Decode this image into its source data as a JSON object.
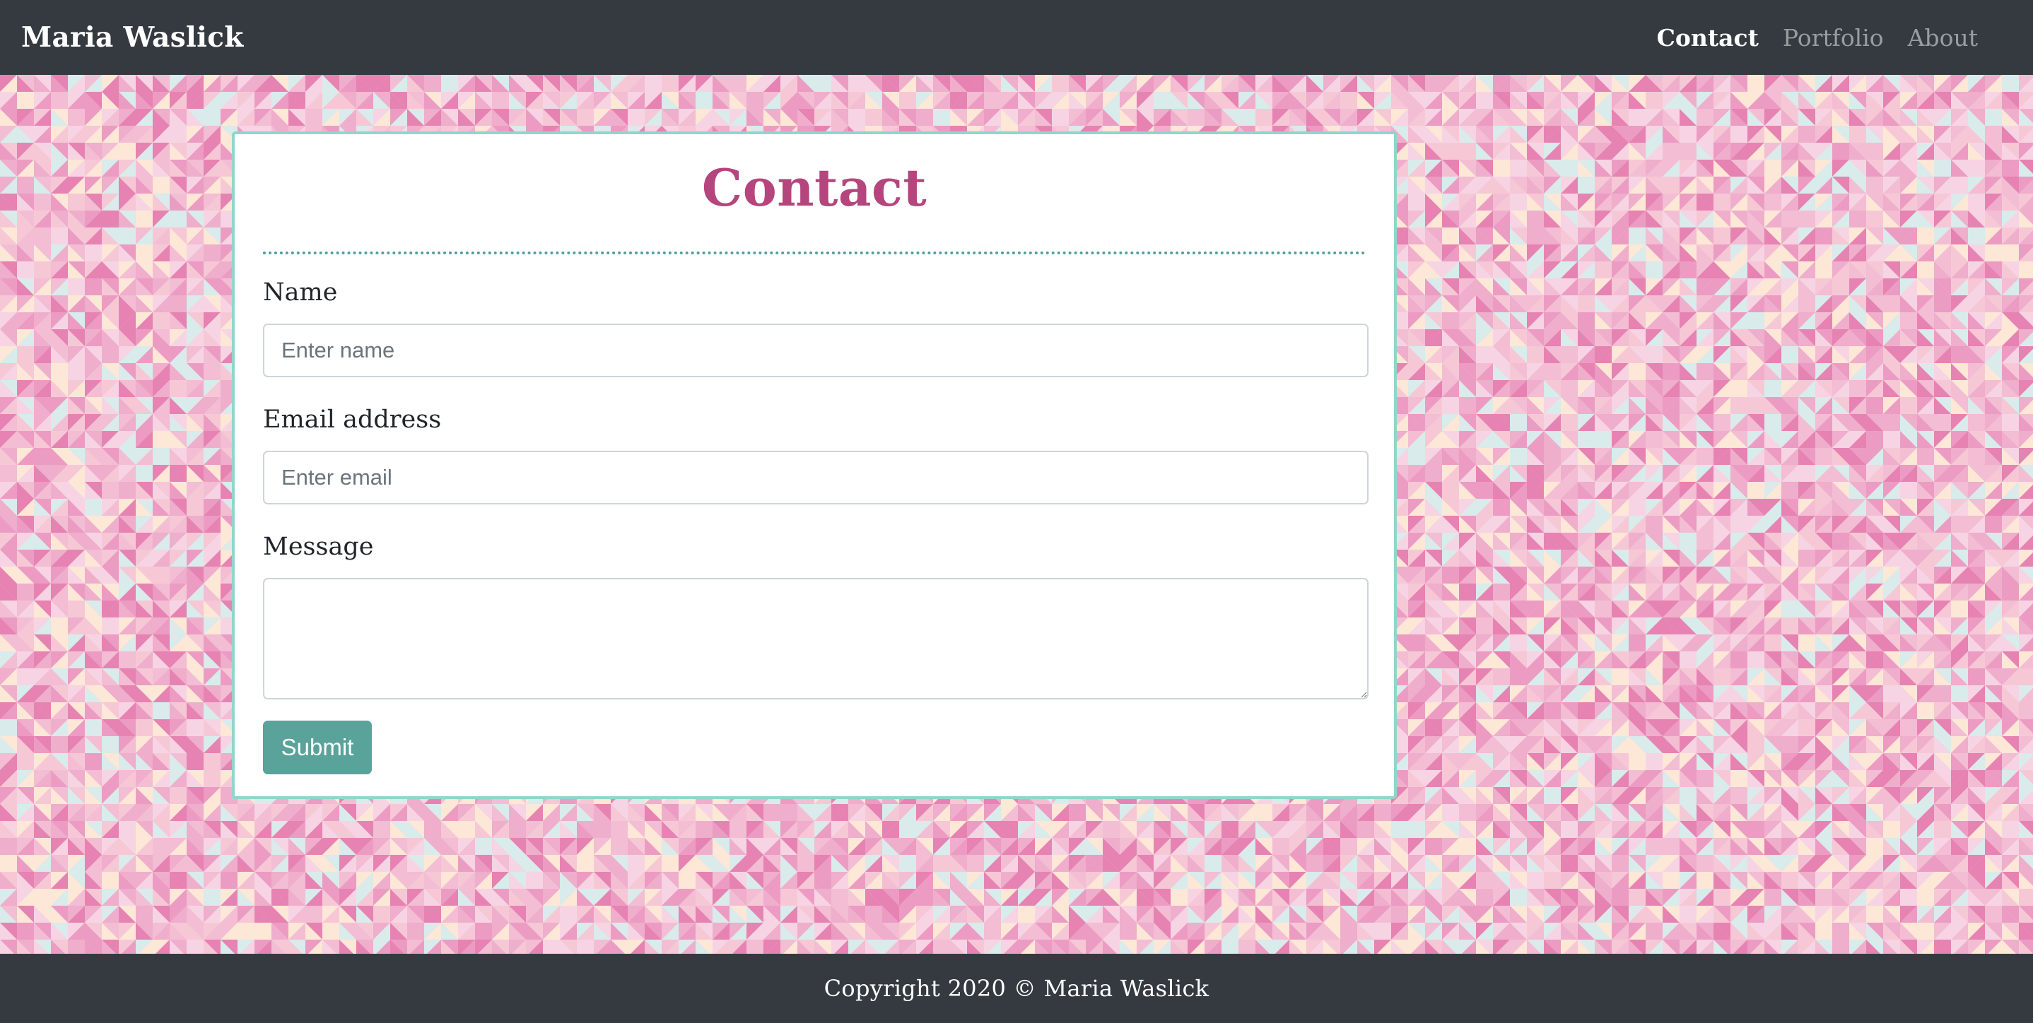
{
  "navbar": {
    "brand": "Maria Waslick",
    "links": [
      {
        "label": "Contact",
        "active": true
      },
      {
        "label": "Portfolio",
        "active": false
      },
      {
        "label": "About",
        "active": false
      }
    ]
  },
  "contact": {
    "title": "Contact",
    "name_label": "Name",
    "name_placeholder": "Enter name",
    "email_label": "Email address",
    "email_placeholder": "Enter email",
    "message_label": "Message",
    "message_value": "",
    "submit_label": "Submit"
  },
  "footer": {
    "text": "Copyright 2020 © Maria Waslick"
  },
  "colors": {
    "navbar_bg": "#343a40",
    "title_color": "#b5457d",
    "card_border": "#8fd6cc",
    "divider": "#4f9e9e",
    "button_bg": "#5aa39b",
    "pattern_palette": [
      "#f7d4e3",
      "#f3bdd4",
      "#ec9cc3",
      "#e683b2",
      "#fde7d6",
      "#d9ebeb",
      "#f6c8d6",
      "#efaecb"
    ]
  }
}
